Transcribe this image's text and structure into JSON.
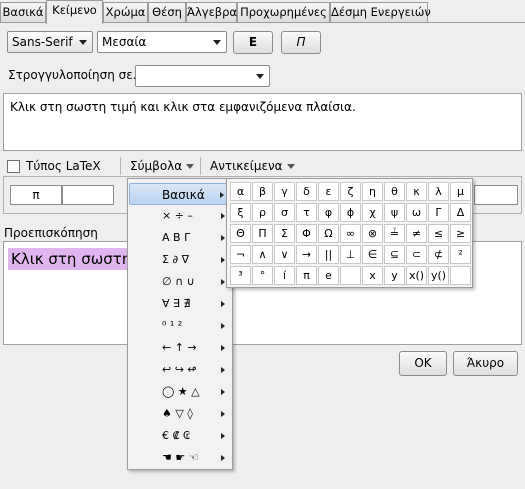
{
  "tabs": [
    {
      "label": "Βασικά",
      "active": false
    },
    {
      "label": "Κείμενο",
      "active": true
    },
    {
      "label": "Χρώμα",
      "active": false
    },
    {
      "label": "Θέση",
      "active": false
    },
    {
      "label": "Άλγεβρα",
      "active": false
    },
    {
      "label": "Προχωρημένες",
      "active": false
    },
    {
      "label": "Δέσμη Ενεργειών",
      "active": false
    }
  ],
  "format": {
    "font_family": "Sans-Serif",
    "font_size": "Μεσαία",
    "bold_label": "Ε",
    "italic_label": "Π"
  },
  "rounding": {
    "label": "Στρογγυλοποίηση σε...:",
    "value": ""
  },
  "editor": {
    "text": "Κλικ στη σωστη τιμή  και κλικ στα εμφανιζόμενα πλαίσια."
  },
  "toolbar": {
    "latex_label": "Τύπος LaTeX",
    "latex_checked": false,
    "symbols_label": "Σύμβολα",
    "objects_label": "Αντικείμενα"
  },
  "symbol_field": {
    "cells": [
      "π",
      "",
      ""
    ]
  },
  "preview": {
    "label": "Προεπισκόπηση",
    "text": "Κλικ στη σωστη τιμή  και κλικ στα εμφανιζόμενα πλαίσια."
  },
  "dialog": {
    "ok_label": "OK",
    "cancel_label": "Άκυρο"
  },
  "symbols_menu": {
    "items": [
      {
        "label": "Βασικά",
        "selected": true
      },
      {
        "label": "× ÷ –",
        "selected": false
      },
      {
        "label": "Α Β Γ",
        "selected": false
      },
      {
        "label": "Σ ∂ ∇",
        "selected": false
      },
      {
        "label": "∅ ∩ ∪",
        "selected": false
      },
      {
        "label": "∀ ∃ ∄",
        "selected": false
      },
      {
        "label": "⁰ ¹ ²",
        "selected": false
      },
      {
        "label": "← ↑ →",
        "selected": false
      },
      {
        "label": "↩ ↪ ↫",
        "selected": false
      },
      {
        "label": "◯ ★ △",
        "selected": false
      },
      {
        "label": "♠ ▽ ◊",
        "selected": false
      },
      {
        "label": "€ ₡ ₢",
        "selected": false
      },
      {
        "label": "☚ ☛ ☜",
        "selected": false
      }
    ]
  },
  "symbol_grid": [
    [
      "α",
      "β",
      "γ",
      "δ",
      "ε",
      "ζ",
      "η",
      "θ",
      "κ",
      "λ",
      "μ"
    ],
    [
      "ξ",
      "ρ",
      "σ",
      "τ",
      "φ",
      "ϕ",
      "χ",
      "ψ",
      "ω",
      "Γ",
      "Δ"
    ],
    [
      "Θ",
      "Π",
      "Σ",
      "Φ",
      "Ω",
      "∞",
      "⊗",
      "≟",
      "≠",
      "≤",
      "≥"
    ],
    [
      "¬",
      "∧",
      "∨",
      "→",
      "||",
      "⊥",
      "∈",
      "⊆",
      "⊂",
      "⊄",
      "²"
    ],
    [
      "³",
      "°",
      "í",
      "π",
      "e",
      "",
      "x",
      "y",
      "x()",
      "y()",
      ""
    ]
  ]
}
